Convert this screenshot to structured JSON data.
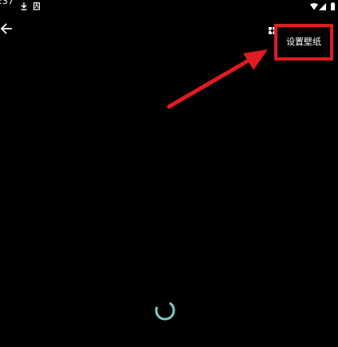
{
  "status_bar": {
    "time": ":37",
    "icons": [
      "download-icon",
      "notification-icon",
      "wifi-icon",
      "signal-icon",
      "battery-icon"
    ]
  },
  "toolbar": {
    "back_icon": "arrow-left-icon",
    "options_icon": "wallpaper-options-icon",
    "set_wallpaper_label": "设置壁纸"
  },
  "annotation": {
    "highlight_color": "#e01b22",
    "arrow_color": "#e01b22"
  },
  "loading": {
    "spinner_color": "#80cbc4"
  }
}
